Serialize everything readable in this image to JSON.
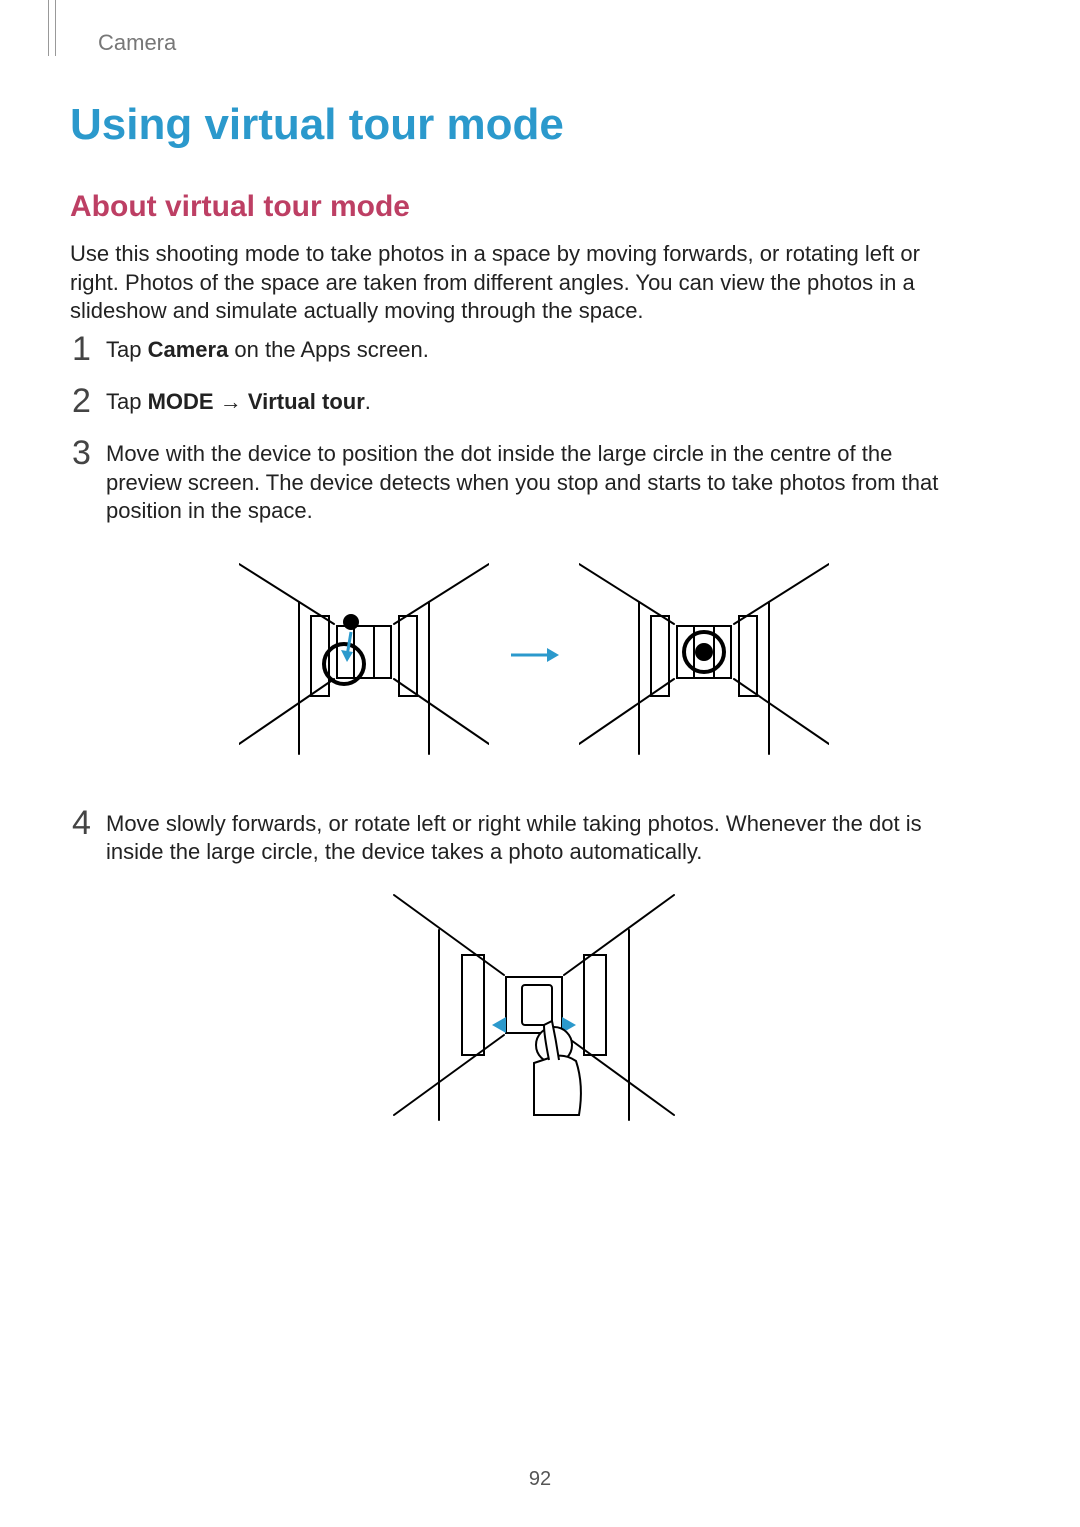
{
  "header": {
    "section": "Camera"
  },
  "title": "Using virtual tour mode",
  "subtitle": "About virtual tour mode",
  "intro": "Use this shooting mode to take photos in a space by moving forwards, or rotating left or right. Photos of the space are taken from different angles. You can view the photos in a slideshow and simulate actually moving through the space.",
  "steps": {
    "s1": {
      "num": "1",
      "pre": "Tap ",
      "bold": "Camera",
      "post": " on the Apps screen."
    },
    "s2": {
      "num": "2",
      "pre": "Tap ",
      "bold1": "MODE",
      "arrow": " → ",
      "bold2": "Virtual tour",
      "post": "."
    },
    "s3": {
      "num": "3",
      "text": "Move with the device to position the dot inside the large circle in the centre of the preview screen. The device detects when you stop and starts to take photos from that position in the space."
    },
    "s4": {
      "num": "4",
      "text": "Move slowly forwards, or rotate left or right while taking photos. Whenever the dot is inside the large circle, the device takes a photo automatically."
    }
  },
  "page_number": "92"
}
